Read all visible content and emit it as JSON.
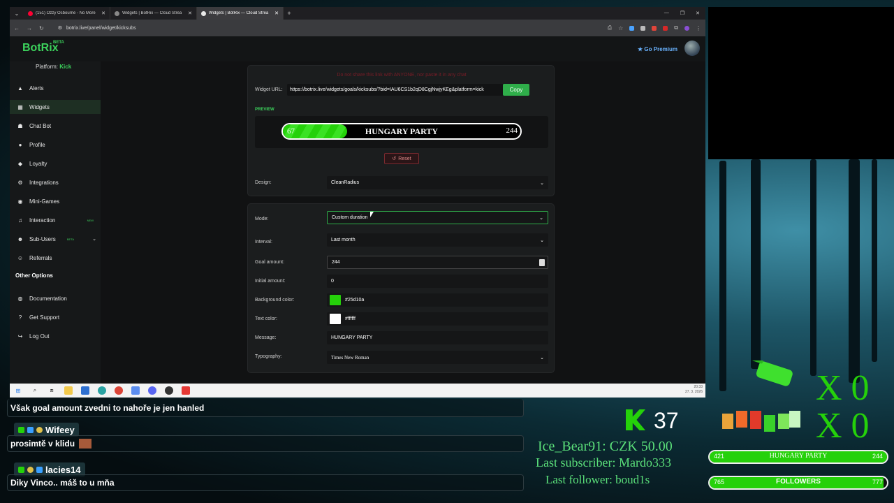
{
  "browser": {
    "tabs": [
      {
        "label": "(151) Ozzy Osbourne - No More",
        "active": false,
        "color": "#ff0033"
      },
      {
        "label": "Widgets | BotRix — Cloud Strea",
        "active": false,
        "color": "#888888"
      },
      {
        "label": "Widgets | BotRix — Cloud Strea",
        "active": true,
        "color": "#e8e8e8"
      }
    ],
    "url": "botrix.live/panel/widget/kicksubs"
  },
  "app": {
    "brand": "BotRix",
    "brand_badge": "BETA",
    "go_premium": "Go Premium",
    "platform_label": "Platform:",
    "platform_value": "Kick",
    "accent": "#3cd25c"
  },
  "sidebar": {
    "items": [
      {
        "label": "Alerts",
        "icon": "warning-icon"
      },
      {
        "label": "Widgets",
        "icon": "grid-icon",
        "active": true
      },
      {
        "label": "Chat Bot",
        "icon": "robot-icon"
      },
      {
        "label": "Profile",
        "icon": "user-icon"
      },
      {
        "label": "Loyalty",
        "icon": "tag-icon"
      },
      {
        "label": "Integrations",
        "icon": "plug-icon"
      },
      {
        "label": "Mini-Games",
        "icon": "gamepad-icon"
      },
      {
        "label": "Interaction",
        "icon": "music-icon",
        "tag": "NEW"
      },
      {
        "label": "Sub-Users",
        "icon": "users-icon",
        "tag": "BETA"
      },
      {
        "label": "Referrals",
        "icon": "people-icon"
      }
    ],
    "other_options_title": "Other Options",
    "other_items": [
      {
        "label": "Documentation",
        "icon": "globe-icon"
      },
      {
        "label": "Get Support",
        "icon": "help-icon"
      },
      {
        "label": "Log Out",
        "icon": "logout-icon"
      }
    ]
  },
  "widget": {
    "warning": "Do not share this link with ANYONE, nor paste it in any chat",
    "url_label": "Widget URL:",
    "url_value": "https://botrix.live/widgets/goals/kicksubs/?bid=IAU6CS1b2qD8CgjNwjyKEg&platform=kick",
    "copy_label": "Copy",
    "preview_label": "PREVIEW",
    "preview": {
      "current": "67",
      "message": "HUNGARY PARTY",
      "target": "244",
      "progress": 0.27
    },
    "reset_label": "Reset",
    "design_label": "Design:",
    "design_value": "CleanRadius",
    "mode_label": "Mode:",
    "mode_value": "Custom duration",
    "interval_label": "Interval:",
    "interval_value": "Last month",
    "goal_label": "Goal amount:",
    "goal_value": "244",
    "initial_label": "Initial amount:",
    "initial_value": "0",
    "bg_color_label": "Background color:",
    "bg_color_value": "#25d10a",
    "text_color_label": "Text color:",
    "text_color_value": "#ffffff",
    "message_label": "Message:",
    "message_value": "HUNGARY PARTY",
    "typography_label": "Typography:",
    "typography_value": "Times New Roman"
  },
  "taskbar": {
    "time": "20:33",
    "date": "27. 3. 2026"
  },
  "chat": {
    "lines": [
      {
        "text": "Však goal amount zvedni to nahoře je jen hanled"
      },
      {
        "user": "Wifeey",
        "text": "prosimtě v klidu"
      },
      {
        "user": "lacies14",
        "text": "Diky Vinco.. máš to u mňa"
      }
    ]
  },
  "overlay": {
    "kick_count": "37",
    "donation": "Ice_Bear91: CZK 50.00",
    "last_subscriber": "Last subscriber: Mardo333",
    "last_follower": "Last follower: boud1s",
    "shots_x1": "X 0",
    "shots_x2": "X 0",
    "bar1": {
      "left": "421",
      "label": "HUNGARY PARTY",
      "right": "244",
      "progress": 1.0
    },
    "bar2": {
      "left": "765",
      "label": "FOLLOWERS",
      "right": "777",
      "progress": 0.98
    }
  }
}
